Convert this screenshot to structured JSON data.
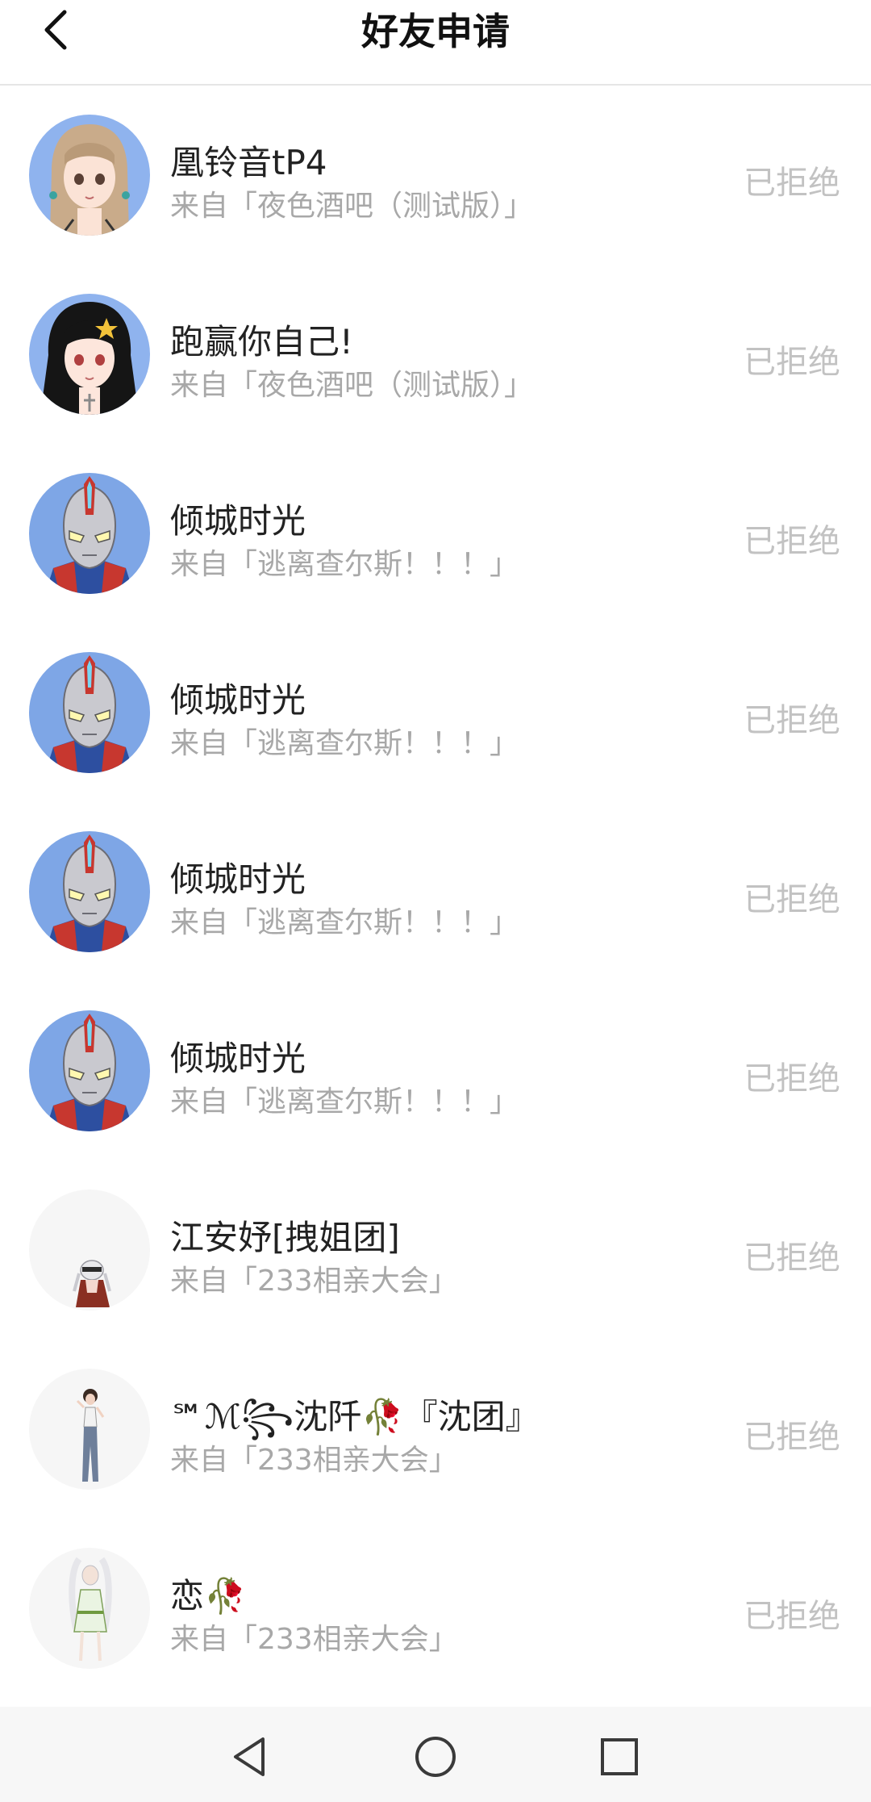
{
  "header": {
    "title": "好友申请",
    "back_icon": "chevron-left-icon"
  },
  "requests": [
    {
      "name": "凰铃音tP4",
      "source": "来自「夜色酒吧（测试版）」",
      "status": "已拒绝",
      "avatar": "anime-girl-brown-hair-avatar"
    },
    {
      "name": "跑赢你自己!",
      "source": "来自「夜色酒吧（测试版）」",
      "status": "已拒绝",
      "avatar": "anime-girl-black-hair-avatar"
    },
    {
      "name": "倾城时光",
      "source": "来自「逃离查尔斯！！！」",
      "status": "已拒绝",
      "avatar": "ultraman-avatar"
    },
    {
      "name": "倾城时光",
      "source": "来自「逃离查尔斯！！！」",
      "status": "已拒绝",
      "avatar": "ultraman-avatar"
    },
    {
      "name": "倾城时光",
      "source": "来自「逃离查尔斯！！！」",
      "status": "已拒绝",
      "avatar": "ultraman-avatar"
    },
    {
      "name": "倾城时光",
      "source": "来自「逃离查尔斯！！！」",
      "status": "已拒绝",
      "avatar": "ultraman-avatar"
    },
    {
      "name": "江安妤[拽姐团]",
      "source": "来自「233相亲大会」",
      "status": "已拒绝",
      "avatar": "white-hair-character-avatar"
    },
    {
      "name": "℠ℳ꧂沈阡🥀『沈团』",
      "source": "来自「233相亲大会」",
      "status": "已拒绝",
      "avatar": "standing-girl-avatar"
    },
    {
      "name": "恋🥀",
      "source": "来自「233相亲大会」",
      "status": "已拒绝",
      "avatar": "white-dress-character-avatar"
    }
  ],
  "system_nav": {
    "back": "triangle-back-icon",
    "home": "circle-home-icon",
    "recents": "square-recents-icon"
  },
  "colors": {
    "title": "#111111",
    "name": "#222222",
    "source": "#a8a8a8",
    "status": "#c2c2c2",
    "divider": "#e6e6e6",
    "navbar": "#f7f7f7",
    "avatar_blue": "#7ea6e6"
  }
}
